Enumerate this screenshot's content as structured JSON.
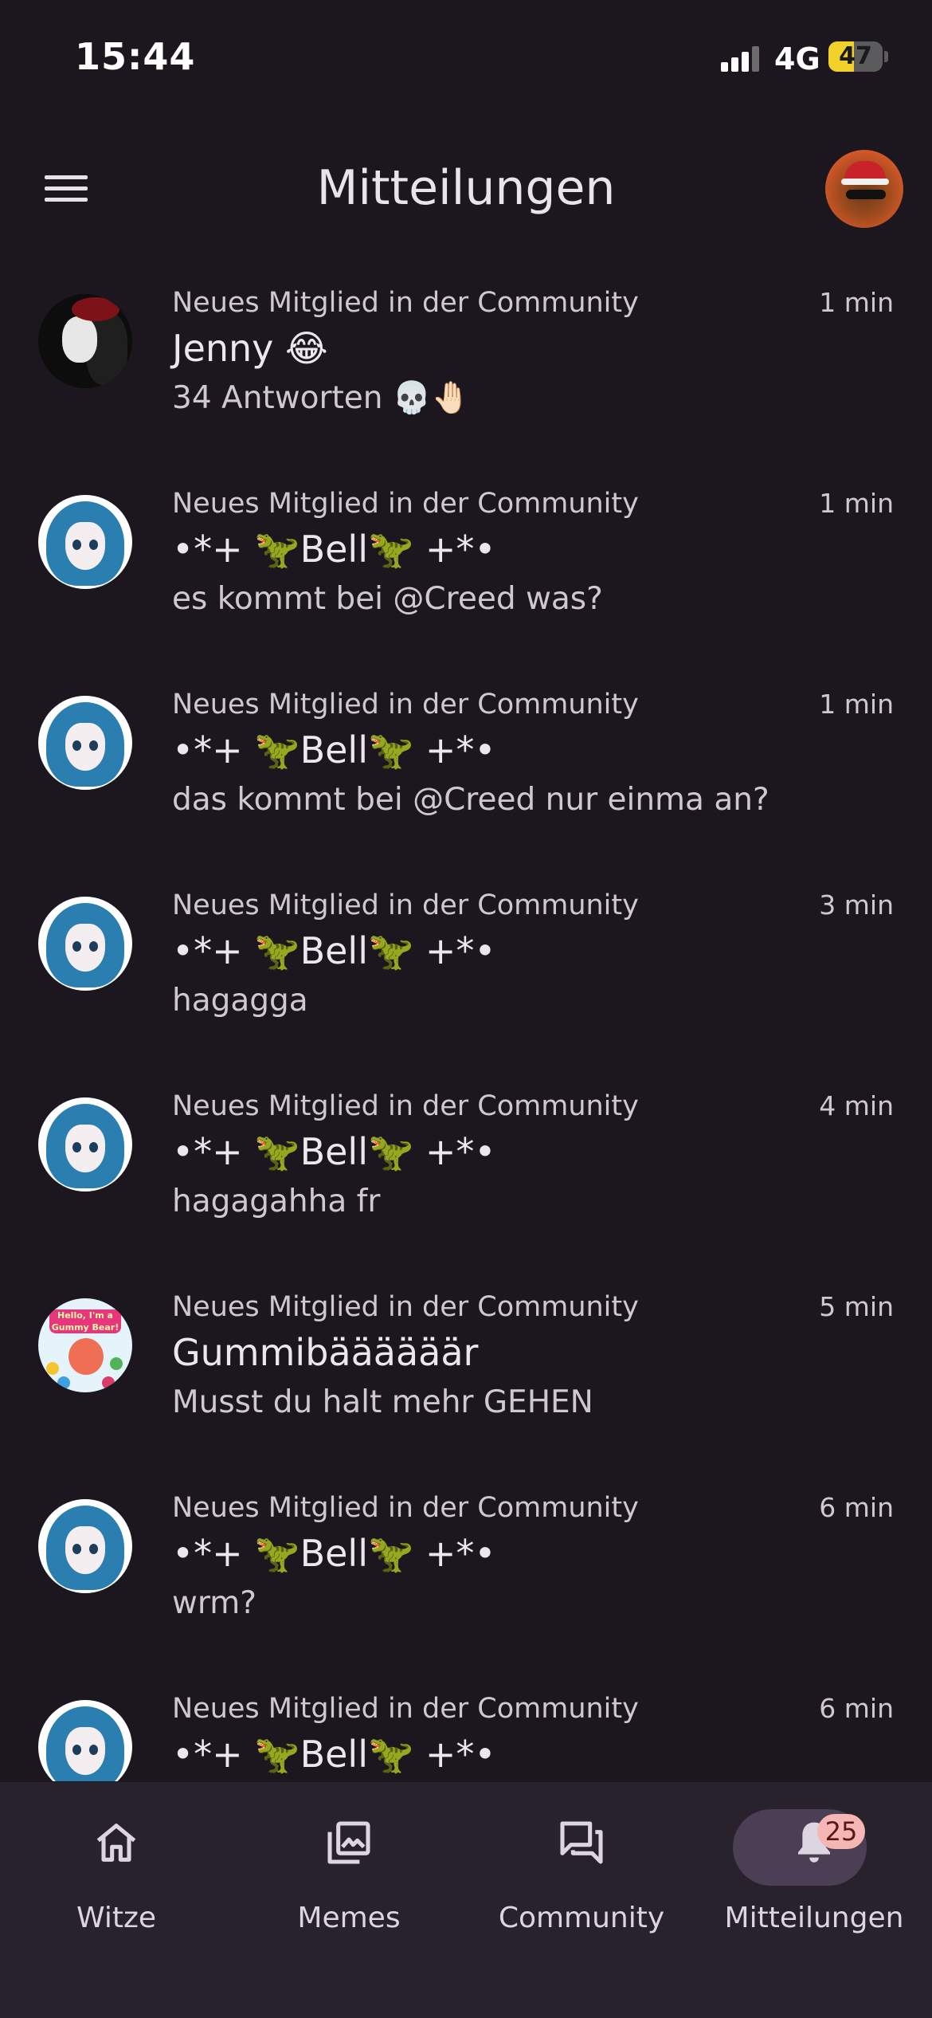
{
  "status_bar": {
    "time": "15:44",
    "network": "4G",
    "battery": "47",
    "battery_level": 0.47
  },
  "header": {
    "title": "Mitteilungen"
  },
  "notifications": [
    {
      "category": "Neues Mitglied in der Community",
      "time": "1 min",
      "author": "Jenny 😂",
      "body": "34 Antworten 💀🤚🏻",
      "avatar": "jenny"
    },
    {
      "category": "Neues Mitglied in der Community",
      "time": "1 min",
      "author": "•*+ 🦖Bell🦖 +*•",
      "body": "es kommt bei @Creed was?",
      "avatar": "anime-girl"
    },
    {
      "category": "Neues Mitglied in der Community",
      "time": "1 min",
      "author": "•*+ 🦖Bell🦖 +*•",
      "body": "das kommt bei @Creed nur einma an?",
      "avatar": "anime-girl"
    },
    {
      "category": "Neues Mitglied in der Community",
      "time": "3 min",
      "author": "•*+ 🦖Bell🦖 +*•",
      "body": "hagagga",
      "avatar": "anime-girl"
    },
    {
      "category": "Neues Mitglied in der Community",
      "time": "4 min",
      "author": "•*+ 🦖Bell🦖 +*•",
      "body": "hagagahha fr",
      "avatar": "anime-girl"
    },
    {
      "category": "Neues Mitglied in der Community",
      "time": "5 min",
      "author": "Gummibäääääär",
      "body": "Musst du halt mehr GEHEN",
      "avatar": "gummy-bear",
      "avatar_text": "Hello, I'm a Gummy Bear!"
    },
    {
      "category": "Neues Mitglied in der Community",
      "time": "6 min",
      "author": "•*+ 🦖Bell🦖 +*•",
      "body": "wrm?",
      "avatar": "anime-girl"
    },
    {
      "category": "Neues Mitglied in der Community",
      "time": "6 min",
      "author": "•*+ 🦖Bell🦖 +*•",
      "body": "",
      "avatar": "anime-girl"
    }
  ],
  "bottom_nav": {
    "items": [
      {
        "label": "Witze",
        "icon": "home-icon"
      },
      {
        "label": "Memes",
        "icon": "gallery-icon"
      },
      {
        "label": "Community",
        "icon": "forum-icon"
      },
      {
        "label": "Mitteilungen",
        "icon": "bell-icon",
        "badge": "25",
        "active": true
      }
    ]
  },
  "colors": {
    "background": "#1c171e",
    "nav_background": "#27222b",
    "active_pill": "#4a3f55",
    "badge": "#f6b6b3"
  }
}
